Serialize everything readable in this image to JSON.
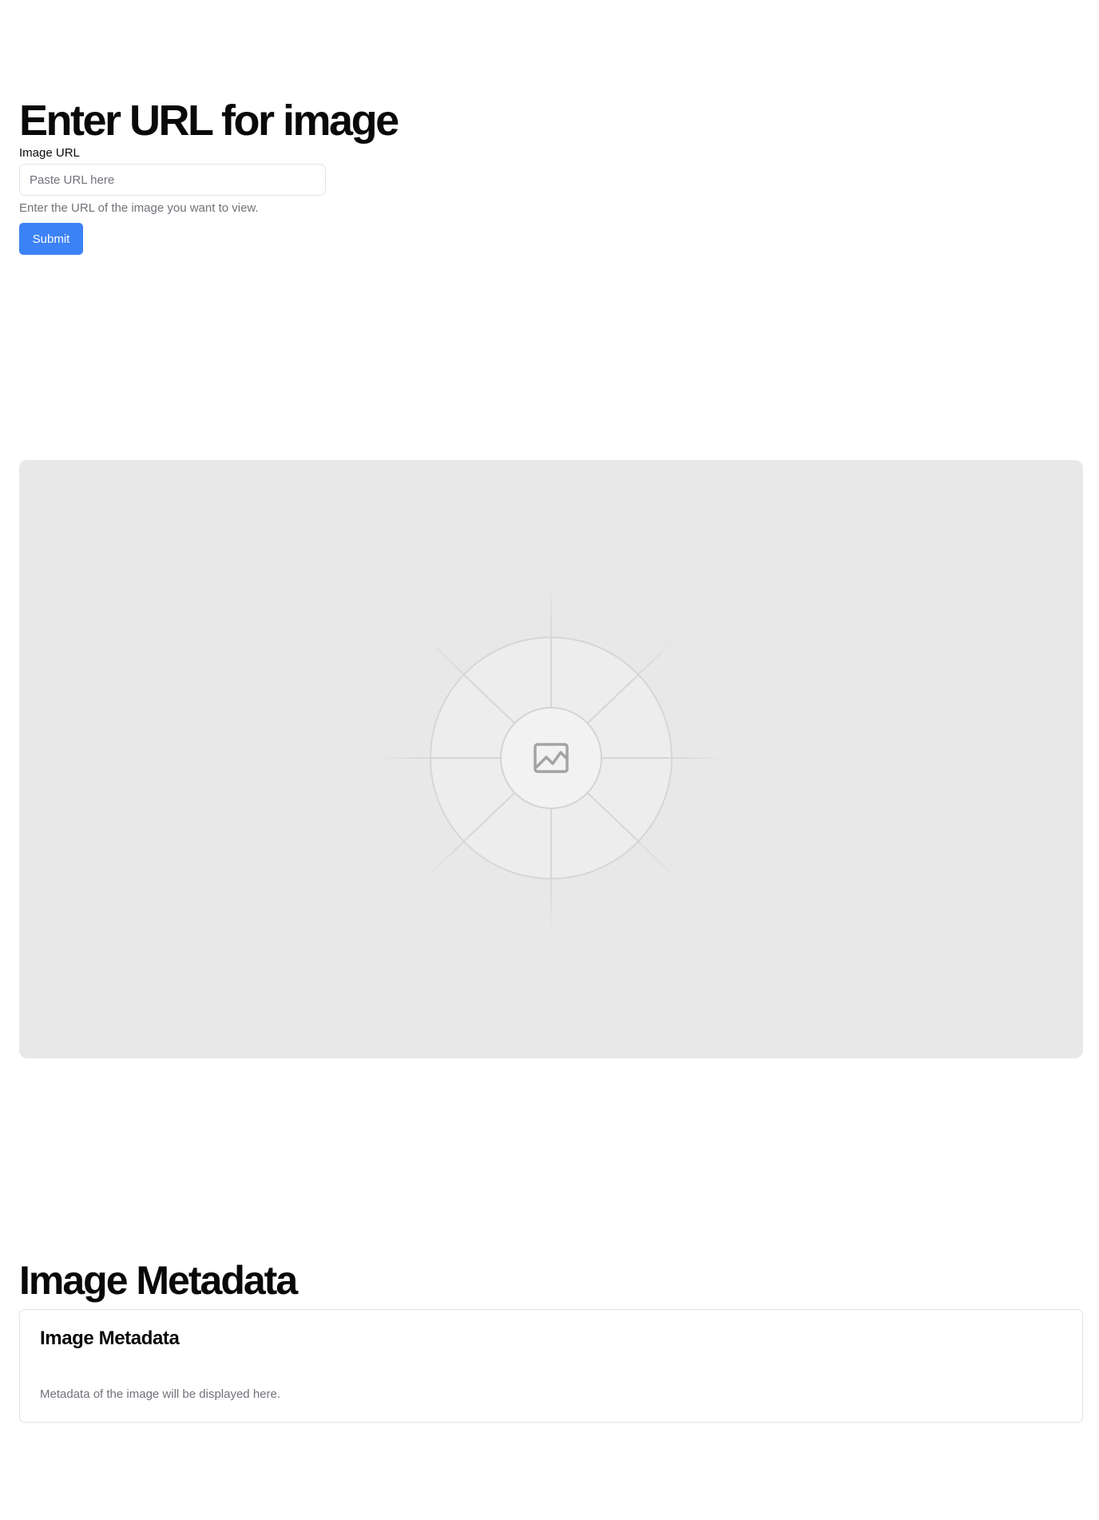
{
  "form": {
    "title": "Enter URL for image",
    "label": "Image URL",
    "placeholder": "Paste URL here",
    "value": "",
    "helper": "Enter the URL of the image you want to view.",
    "submit_label": "Submit"
  },
  "preview": {
    "icon": "image-icon"
  },
  "metadata": {
    "section_title": "Image Metadata",
    "card_title": "Image Metadata",
    "card_text": "Metadata of the image will be displayed here."
  },
  "colors": {
    "accent": "#3b82f6",
    "placeholder_bg": "#e8e8e8",
    "muted_text": "#71717a",
    "border": "#e4e4e7"
  }
}
